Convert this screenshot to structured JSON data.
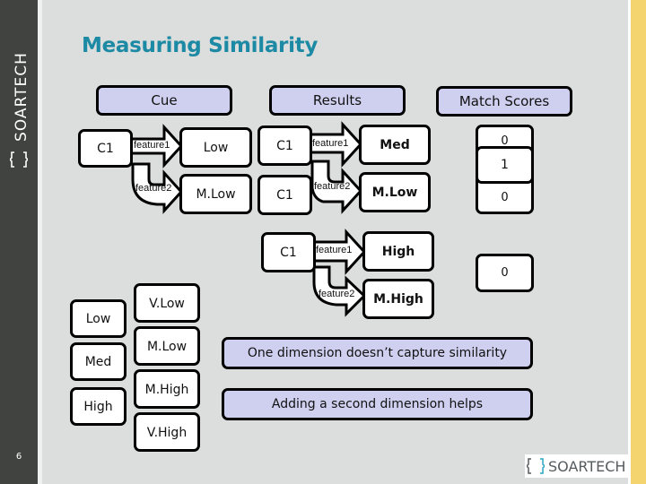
{
  "sidebar": {
    "logo_text": "SOARTECH",
    "page_number": "6"
  },
  "title": "Measuring Similarity",
  "headers": {
    "cue": "Cue",
    "results": "Results",
    "match_scores": "Match Scores"
  },
  "cue": {
    "concept": "C1",
    "feature1_label": "feature1",
    "feature1_value": "Low",
    "feature2_label": "feature2",
    "feature2_value": "M.Low"
  },
  "results": [
    {
      "concept": "C1",
      "feature1_label": "feature1",
      "feature1_value": "Med",
      "feature2_concept": "C1",
      "feature2_label": "feature2",
      "feature2_value": "M.Low"
    },
    {
      "concept": "C1",
      "feature1_label": "feature1",
      "feature1_value": "High",
      "feature2_label": "feature2",
      "feature2_value": "M.High"
    }
  ],
  "match_scores": {
    "stack_back_top": "0",
    "stack_front": "1",
    "stack_back_bottom": "0",
    "single": "0"
  },
  "scale_3": [
    "Low",
    "Med",
    "High"
  ],
  "scale_4": [
    "V.Low",
    "M.Low",
    "M.High",
    "V.High"
  ],
  "notes": [
    "One dimension doesn’t capture similarity",
    "Adding a second dimension helps"
  ],
  "footer": {
    "logo_text": "SOARTECH"
  },
  "colors": {
    "title": "#1c8aa4",
    "header_fill": "#cfd0ef",
    "sidebar": "#414341",
    "accent_bar": "#f3d46e",
    "background": "#dcdddd"
  }
}
